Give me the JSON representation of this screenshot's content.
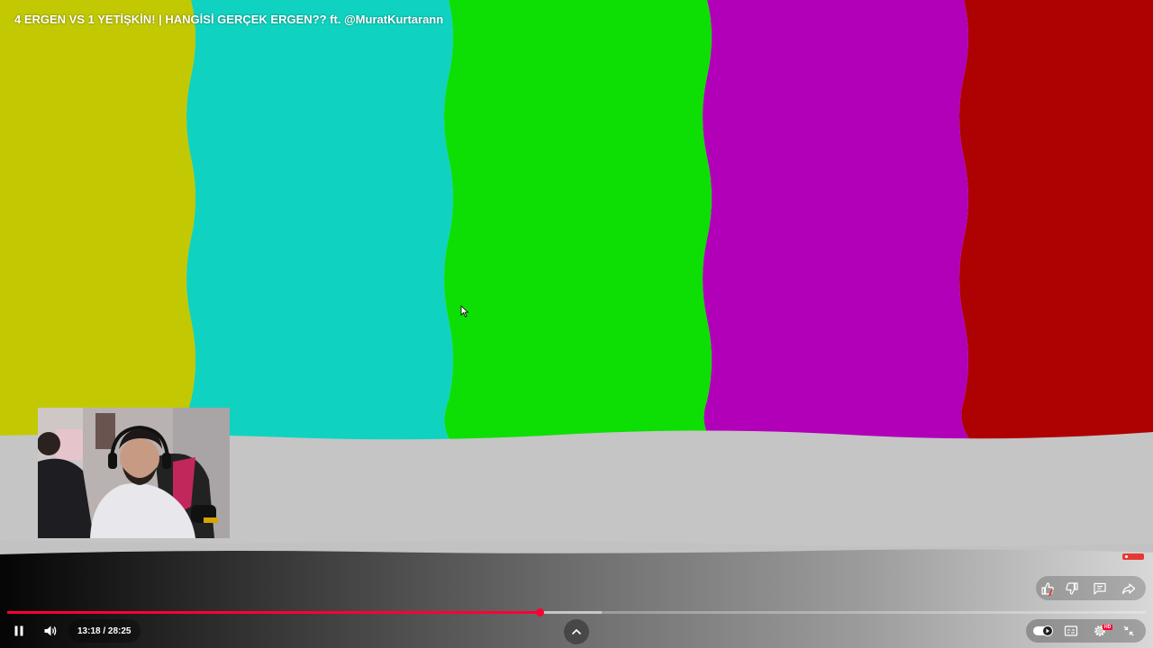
{
  "video": {
    "title": "4 ERGEN VS 1 YETİŞKİN! | HANGİSİ GERÇEK ERGEN?? ft. @MuratKurtarann",
    "test_pattern_colors": [
      "#c2c903",
      "#0fd3c0",
      "#0ddf04",
      "#b100b8",
      "#ae0101",
      "#c5c5c5"
    ]
  },
  "progress": {
    "played_fraction": 0.468,
    "buffered_fraction": 0.522,
    "played_color": "#ff0033"
  },
  "controls": {
    "time_display": "13:18 / 28:25",
    "play_pause_icon": "pause-icon",
    "volume_icon": "volume-icon",
    "expand_icon": "chevron-up-icon",
    "autoplay_icon": "autoplay-toggle-icon",
    "subtitles_icon": "subtitles-icon",
    "settings_icon": "gear-icon",
    "settings_badge": "HD",
    "exit_fullscreen_icon": "exit-fullscreen-icon"
  },
  "actions": {
    "like_icon": "thumbs-up-icon",
    "dislike_icon": "thumbs-down-icon",
    "comments_icon": "comment-icon",
    "share_icon": "share-icon"
  }
}
